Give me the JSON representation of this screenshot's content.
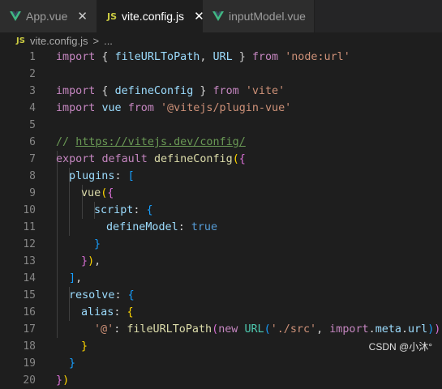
{
  "tabs": [
    {
      "label": "App.vue",
      "icon": "vue-icon",
      "active": false,
      "close": "✕"
    },
    {
      "label": "vite.config.js",
      "icon": "js-icon",
      "icon_text": "JS",
      "active": true,
      "close": "✕"
    },
    {
      "label": "inputModel.vue",
      "icon": "vue-icon",
      "active": false,
      "close": ""
    }
  ],
  "breadcrumb": {
    "icon_text": "JS",
    "file": "vite.config.js",
    "separator": ">",
    "more": "..."
  },
  "line_numbers": [
    "1",
    "2",
    "3",
    "4",
    "5",
    "6",
    "7",
    "8",
    "9",
    "10",
    "11",
    "12",
    "13",
    "14",
    "15",
    "16",
    "17",
    "18",
    "19",
    "20"
  ],
  "code": {
    "l1": {
      "import": "import",
      "ob": " { ",
      "name1": "fileURLToPath",
      "comma": ", ",
      "name2": "URL",
      "cb": " } ",
      "from": "from",
      "sp": " ",
      "src": "'node:url'"
    },
    "l3": {
      "import": "import",
      "ob": " { ",
      "name": "defineConfig",
      "cb": " } ",
      "from": "from",
      "sp": " ",
      "src": "'vite'"
    },
    "l4": {
      "import": "import",
      "sp1": " ",
      "name": "vue",
      "sp2": " ",
      "from": "from",
      "sp3": " ",
      "src": "'@vitejs/plugin-vue'"
    },
    "l6": {
      "prefix": "// ",
      "url": "https://vitejs.dev/config/"
    },
    "l7": {
      "export": "export",
      "sp1": " ",
      "default": "default",
      "sp2": " ",
      "fn": "defineConfig",
      "p": "(",
      "b": "{"
    },
    "l8": {
      "key": "plugins",
      "colon": ": ",
      "b": "["
    },
    "l9": {
      "fn": "vue",
      "p": "(",
      "b": "{"
    },
    "l10": {
      "key": "script",
      "colon": ": ",
      "b": "{"
    },
    "l11": {
      "key": "defineModel",
      "colon": ": ",
      "val": "true"
    },
    "l12": {
      "b": "}"
    },
    "l13": {
      "b": "}",
      "p": ")",
      "end": ","
    },
    "l14": {
      "b": "]",
      "end": ","
    },
    "l15": {
      "key": "resolve",
      "colon": ": ",
      "b": "{"
    },
    "l16": {
      "key": "alias",
      "colon": ": ",
      "b": "{"
    },
    "l17": {
      "key": "'@'",
      "colon": ": ",
      "fn": "fileURLToPath",
      "p1": "(",
      "new": "new",
      "sp": " ",
      "cls": "URL",
      "p2": "(",
      "src": "'./src'",
      "comma": ", ",
      "imp": "import",
      "dot1": ".",
      "meta": "meta",
      "dot2": ".",
      "url": "url",
      "p3": ")",
      "p4": ")"
    },
    "l18": {
      "b": "}"
    },
    "l19": {
      "b": "}"
    },
    "l20": {
      "b": "}",
      "p": ")"
    }
  },
  "watermark": "CSDN @小沐°",
  "colors": {
    "keyword": "#c586c0",
    "function": "#dcdcaa",
    "variable": "#9cdcfe",
    "string": "#ce9178",
    "comment": "#6a9955",
    "vue_green": "#41b883",
    "js_yellow": "#cbcb41"
  }
}
